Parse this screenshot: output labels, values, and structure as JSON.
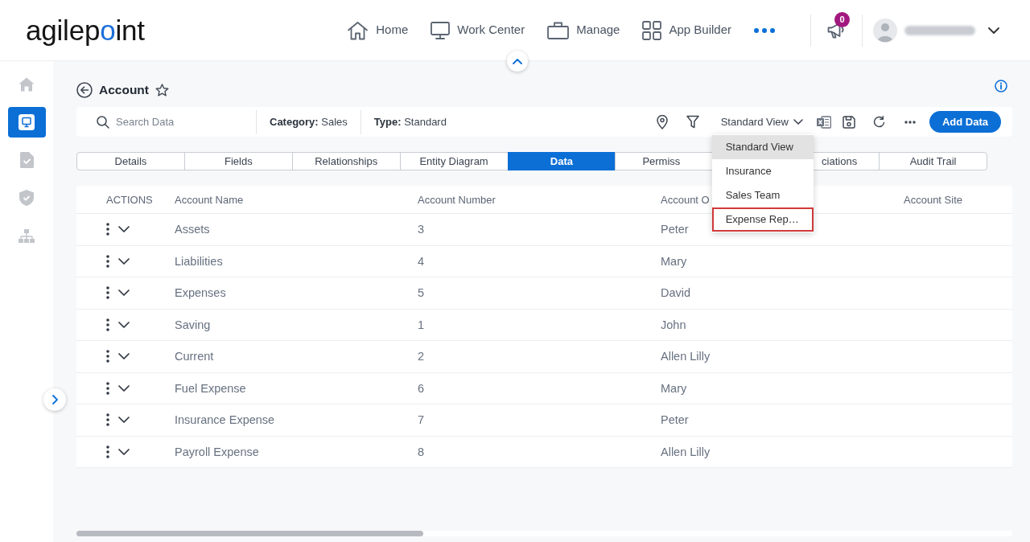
{
  "header": {
    "logo": "agilepoint",
    "nav": [
      {
        "label": "Home"
      },
      {
        "label": "Work Center"
      },
      {
        "label": "Manage"
      },
      {
        "label": "App Builder"
      }
    ],
    "notifications": {
      "count": "0"
    }
  },
  "sidebar": {
    "items": [
      {
        "selected": false
      },
      {
        "selected": true
      },
      {
        "selected": false
      },
      {
        "selected": false
      },
      {
        "selected": false
      }
    ]
  },
  "page": {
    "title": "Account",
    "favorite": false
  },
  "toolbar": {
    "search": {
      "placeholder": "Search Data"
    },
    "meta": [
      "**Category:** Sales",
      "**Type:** Standard"
    ],
    "view_select": {
      "value": "Standard View",
      "expanded": true,
      "options": [
        {
          "label": "Standard View",
          "selected": true,
          "highlighted": false
        },
        {
          "label": "Insurance",
          "selected": false,
          "highlighted": false
        },
        {
          "label": "Sales Team",
          "selected": false,
          "highlighted": false
        },
        {
          "label": "Expense Rep…",
          "selected": false,
          "highlighted": true
        }
      ]
    },
    "add_button": "Add Data"
  },
  "tabs": [
    {
      "label": "Details",
      "selected": false
    },
    {
      "label": "Fields",
      "selected": false
    },
    {
      "label": "Relationships",
      "selected": false
    },
    {
      "label": "Entity Diagram",
      "selected": false
    },
    {
      "label": "Data",
      "selected": true
    },
    {
      "label": "Permiss",
      "selected": false
    },
    {
      "label": "ciations",
      "selected": false
    },
    {
      "label": "Audit Trail",
      "selected": false
    }
  ],
  "table": {
    "columns": [
      "ACTIONS",
      "Account Name",
      "Account Number",
      "Account O",
      "Account Site"
    ],
    "rows": [
      [
        "",
        "Assets",
        "3",
        "Peter"
      ],
      [
        "",
        "Liabilities",
        "4",
        "Mary"
      ],
      [
        "",
        "Expenses",
        "5",
        "David"
      ],
      [
        "",
        "Saving",
        "1",
        "John"
      ],
      [
        "",
        "Current",
        "2",
        "Allen Lilly"
      ],
      [
        "",
        "Fuel Expense",
        "6",
        "Mary"
      ],
      [
        "",
        "Insurance Expense",
        "7",
        "Peter"
      ],
      [
        "",
        "Payroll Expense",
        "8",
        "Allen Lilly"
      ]
    ]
  }
}
